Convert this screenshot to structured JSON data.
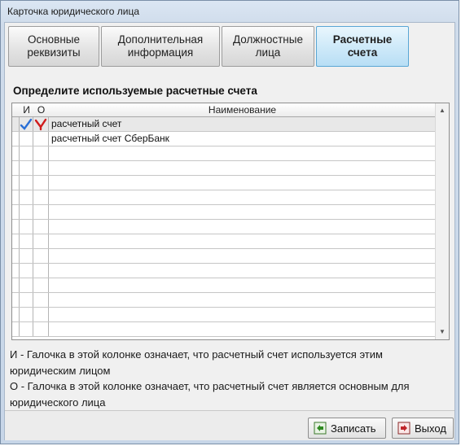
{
  "window": {
    "title": "Карточка юридического лица"
  },
  "tabs": [
    {
      "label": "Основные\nреквизиты",
      "active": false
    },
    {
      "label": "Дополнительная\nинформация",
      "active": false
    },
    {
      "label": "Должностные\nлица",
      "active": false
    },
    {
      "label": "Расчетные\nсчета",
      "active": true
    }
  ],
  "section": {
    "title": "Определите используемые расчетные счета"
  },
  "grid": {
    "headers": {
      "used": "И",
      "main": "О",
      "name": "Наименование"
    },
    "rows": [
      {
        "name": "расчетный счет",
        "used": true,
        "main": true,
        "selected": true
      },
      {
        "name": "расчетный счет СберБанк",
        "used": false,
        "main": false,
        "selected": false
      }
    ],
    "empty_rows": 13
  },
  "legend": {
    "used": "И - Галочка в этой колонке означает, что расчетный счет используется этим юридическим лицом",
    "main": "О - Галочка в этой колонке означает, что расчетный счет является основным для юридического лица"
  },
  "buttons": {
    "save": "Записать",
    "exit": "Выход"
  },
  "colors": {
    "check_used": "#2a6fd6",
    "check_main": "#d01c1c",
    "active_tab": "#cfeaf9"
  },
  "icons": {
    "save": "save-icon",
    "exit": "exit-icon",
    "scroll_up": "arrow-up-icon",
    "scroll_down": "arrow-down-icon"
  }
}
